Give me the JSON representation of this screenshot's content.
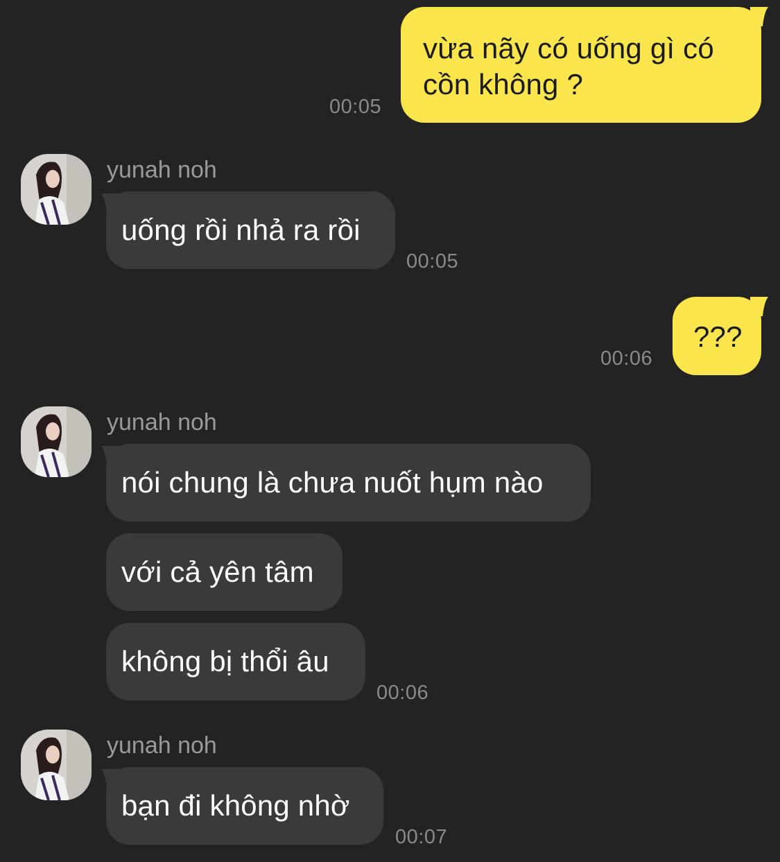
{
  "colors": {
    "background": "#232323",
    "outgoing_bubble": "#FAE54C",
    "incoming_bubble": "#3a3a3c",
    "timestamp": "#8a8a8a",
    "sender_name": "#9a9a9a"
  },
  "messages": {
    "m1": {
      "line1": "vừa nãy có uống gì có",
      "line2": "cồn không ?",
      "time": "00:05"
    },
    "g1": {
      "sender": "yunah noh",
      "text": "uống rồi nhả ra rồi",
      "time": "00:05"
    },
    "m2": {
      "text": "???",
      "time": "00:06"
    },
    "g2": {
      "sender": "yunah noh",
      "text1": "nói chung là chưa nuốt hụm nào",
      "text2": "với cả yên tâm",
      "text3": "không bị thổi âu",
      "time": "00:06"
    },
    "g3": {
      "sender": "yunah noh",
      "text": "bạn đi không nhờ",
      "time": "00:07"
    }
  }
}
